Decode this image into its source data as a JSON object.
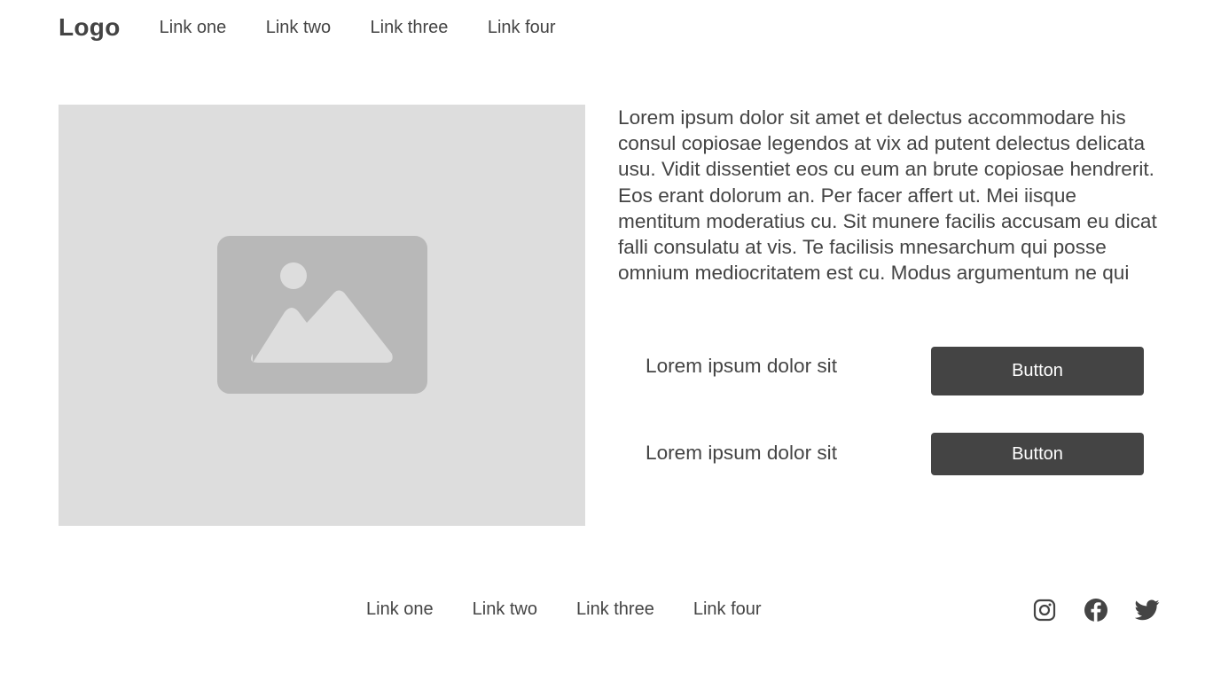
{
  "header": {
    "logo": "Logo",
    "links": [
      "Link one",
      "Link two",
      "Link three",
      "Link four"
    ]
  },
  "main": {
    "image_icon": "image-placeholder-icon",
    "paragraph": "Lorem ipsum dolor sit amet et delectus accommodare his consul copiosae legendos at vix ad putent delectus delicata usu. Vidit dissentiet eos cu eum an brute copiosae hendrerit. Eos erant dolorum an. Per facer affert ut. Mei iisque mentitum moderatius cu. Sit munere facilis accusam eu dicat falli consulatu at vis. Te facilisis mnesarchum qui posse omnium mediocritatem est cu. Modus argumentum ne qui",
    "rows": [
      {
        "label": "Lorem ipsum dolor sit",
        "button": "Button"
      },
      {
        "label": "Lorem ipsum dolor sit",
        "button": "Button"
      }
    ]
  },
  "footer": {
    "links": [
      "Link one",
      "Link two",
      "Link three",
      "Link four"
    ],
    "social": [
      "instagram-icon",
      "facebook-icon",
      "twitter-icon"
    ]
  },
  "colors": {
    "text": "#444444",
    "button_bg": "#444444",
    "button_text": "#ffffff",
    "placeholder_bg": "#dddddd",
    "placeholder_icon": "#b8b8b8"
  }
}
